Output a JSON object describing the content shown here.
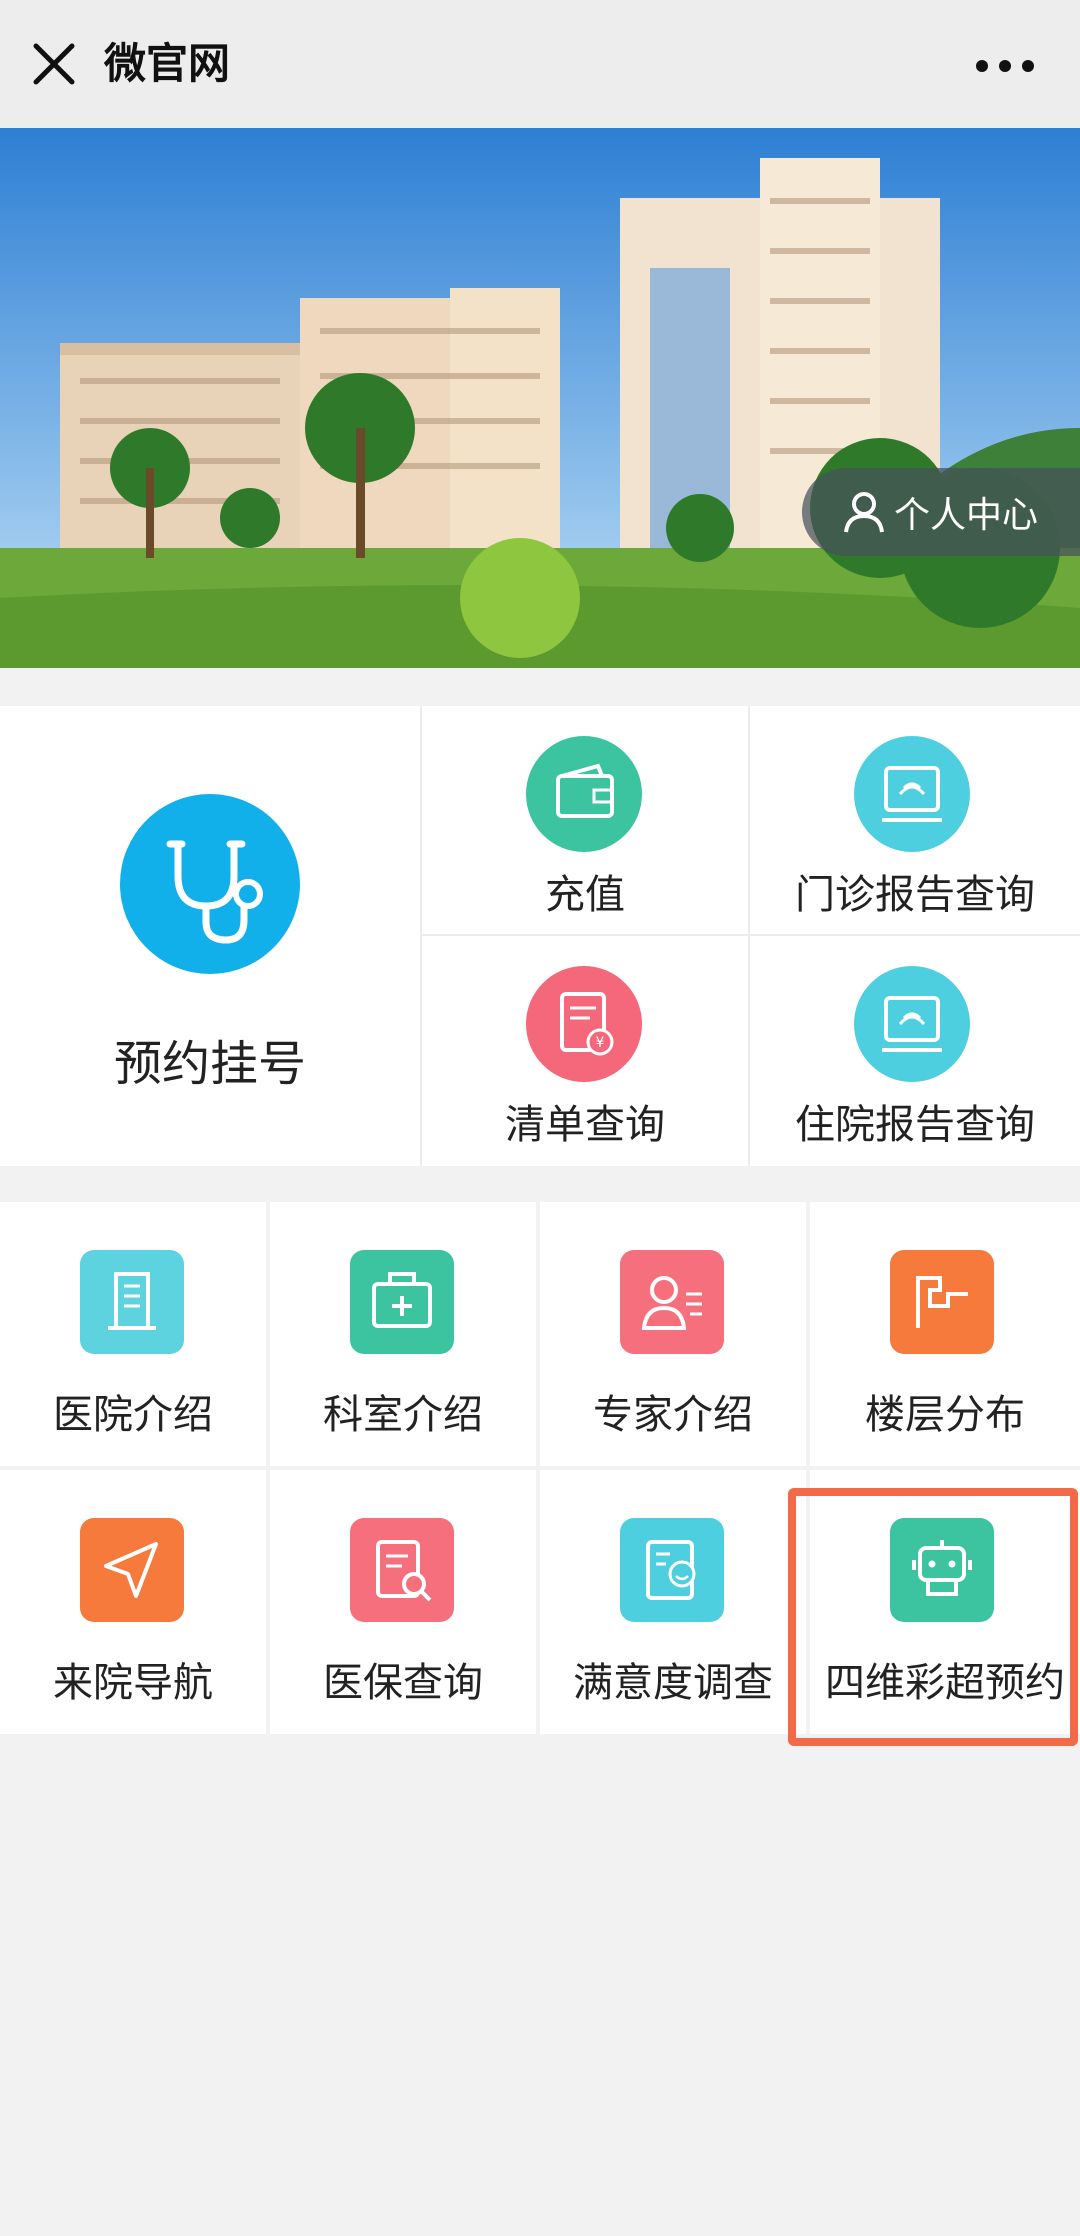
{
  "header": {
    "title": "微官网",
    "close_icon": "close-icon",
    "more_icon": "more-icon"
  },
  "banner": {
    "personal_center_label": "个人中心",
    "slide_count": 3,
    "active_slide": 2
  },
  "main_services": {
    "primary": {
      "label": "预约挂号",
      "icon": "stethoscope-icon",
      "color": "#12b0ea"
    },
    "items": [
      {
        "label": "充值",
        "icon": "wallet-icon",
        "color": "#3cc4a0"
      },
      {
        "label": "门诊报告查询",
        "icon": "ultrasound-icon",
        "color": "#4dcfe0"
      },
      {
        "label": "清单查询",
        "icon": "receipt-icon",
        "color": "#f5677a"
      },
      {
        "label": "住院报告查询",
        "icon": "ultrasound-icon",
        "color": "#4dcfe0"
      }
    ]
  },
  "grid": {
    "items": [
      {
        "label": "医院介绍",
        "icon": "building-icon",
        "color": "#5dd3df"
      },
      {
        "label": "科室介绍",
        "icon": "medical-kit-icon",
        "color": "#3cc4a0"
      },
      {
        "label": "专家介绍",
        "icon": "doctor-profile-icon",
        "color": "#f56f7c"
      },
      {
        "label": "楼层分布",
        "icon": "stairs-icon",
        "color": "#f57a3c"
      },
      {
        "label": "来院导航",
        "icon": "navigation-icon",
        "color": "#f57a3c"
      },
      {
        "label": "医保查询",
        "icon": "document-search-icon",
        "color": "#f56f7c"
      },
      {
        "label": "满意度调查",
        "icon": "survey-smile-icon",
        "color": "#4dcfe0"
      },
      {
        "label": "四维彩超预约",
        "icon": "robot-icon",
        "color": "#3cc4a0"
      }
    ]
  },
  "accent_highlight_color": "#f26a47"
}
